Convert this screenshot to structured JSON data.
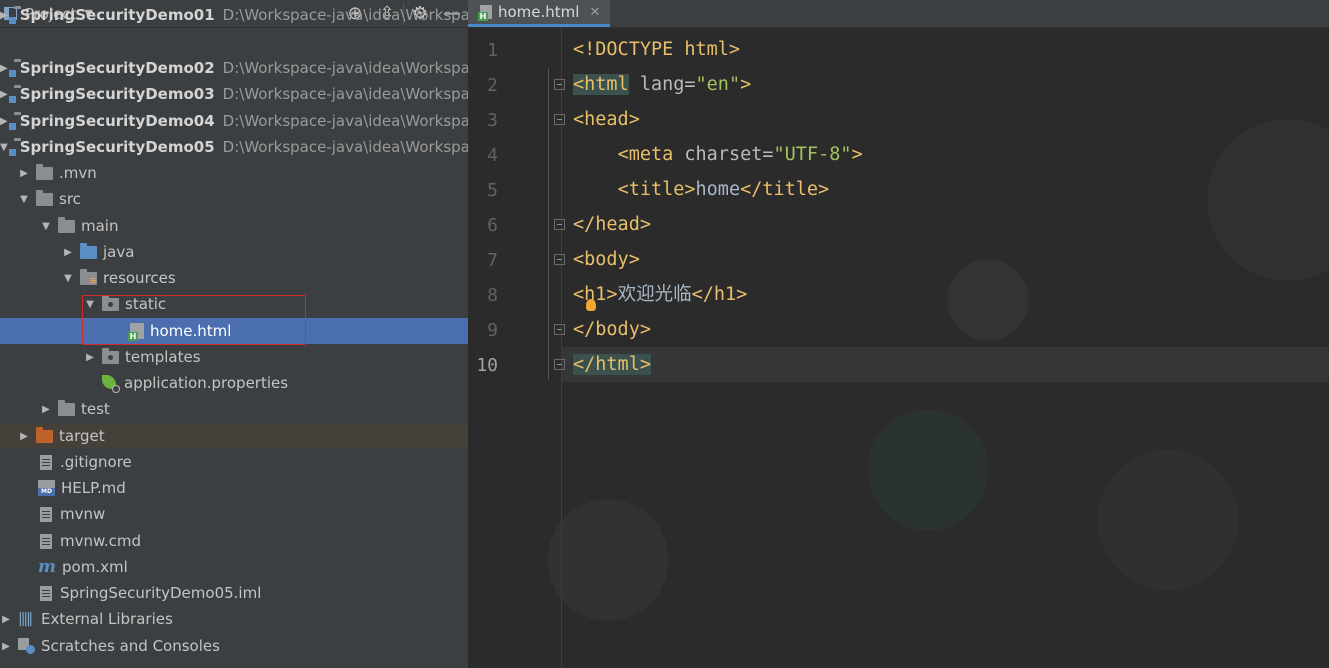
{
  "project_panel": {
    "title": "Project",
    "tree": [
      {
        "label": "SpringSecurityDemo01",
        "path": "D:\\Workspace-java\\idea\\Workspac"
      },
      {
        "label": "SpringSecurityDemo02",
        "path": "D:\\Workspace-java\\idea\\Workspac"
      },
      {
        "label": "SpringSecurityDemo03",
        "path": "D:\\Workspace-java\\idea\\Workspac"
      },
      {
        "label": "SpringSecurityDemo04",
        "path": "D:\\Workspace-java\\idea\\Workspac"
      },
      {
        "label": "SpringSecurityDemo05",
        "path": "D:\\Workspace-java\\idea\\Workspac"
      },
      {
        "label": ".mvn"
      },
      {
        "label": "src"
      },
      {
        "label": "main"
      },
      {
        "label": "java"
      },
      {
        "label": "resources"
      },
      {
        "label": "static"
      },
      {
        "label": "home.html"
      },
      {
        "label": "templates"
      },
      {
        "label": "application.properties"
      },
      {
        "label": "test"
      },
      {
        "label": "target"
      },
      {
        "label": ".gitignore"
      },
      {
        "label": "HELP.md"
      },
      {
        "label": "mvnw"
      },
      {
        "label": "mvnw.cmd"
      },
      {
        "label": "pom.xml"
      },
      {
        "label": "SpringSecurityDemo05.iml"
      },
      {
        "label": "External Libraries"
      },
      {
        "label": "Scratches and Consoles"
      }
    ]
  },
  "editor": {
    "tab": {
      "label": "home.html",
      "close": "✕"
    },
    "line_numbers": [
      "1",
      "2",
      "3",
      "4",
      "5",
      "6",
      "7",
      "8",
      "9",
      "10"
    ],
    "code": {
      "l1_a": "<!DOCTYPE html>",
      "l2_open": "<html",
      "l2_attr": " lang=",
      "l2_val": "\"en\"",
      "l2_close": ">",
      "l3": "<head>",
      "l4_open": "<meta",
      "l4_attr": " charset=",
      "l4_val": "\"UTF-8\"",
      "l4_close": ">",
      "l5_open": "<title>",
      "l5_text": "home",
      "l5_close": "</title>",
      "l6": "</head>",
      "l7": "<body>",
      "l8_open": "<h1>",
      "l8_text": "欢迎光临",
      "l8_close": "</h1>",
      "l9": "</body>",
      "l10": "</html>"
    }
  }
}
